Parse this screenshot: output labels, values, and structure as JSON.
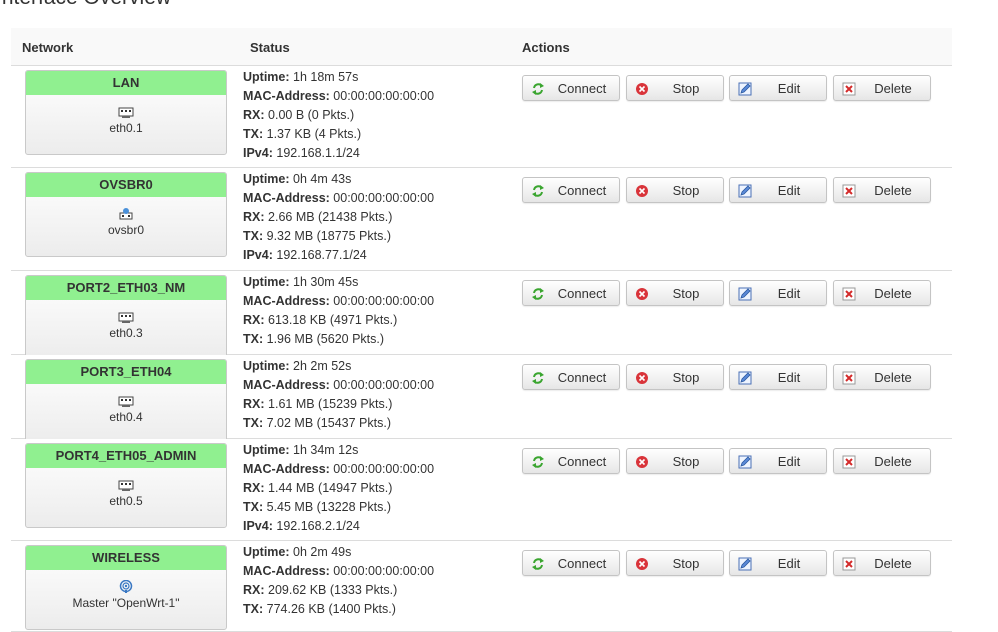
{
  "page": {
    "title": "Interface Overview"
  },
  "table": {
    "headers": {
      "network": "Network",
      "status": "Status",
      "actions": "Actions"
    }
  },
  "buttons": {
    "connect": "Connect",
    "stop": "Stop",
    "edit": "Edit",
    "delete": "Delete"
  },
  "labels": {
    "uptime": "Uptime:",
    "mac": "MAC-Address:",
    "rx": "RX:",
    "tx": "TX:",
    "ipv4": "IPv4:"
  },
  "interfaces": [
    {
      "name": "LAN",
      "device": "eth0.1",
      "icon": "ethernet-port-icon",
      "uptime": "1h 18m 57s",
      "mac": "00:00:00:00:00:00",
      "rx": "0.00 B (0 Pkts.)",
      "tx": "1.37 KB (4 Pkts.)",
      "ipv4": "192.168.1.1/24"
    },
    {
      "name": "OVSBR0",
      "device": "ovsbr0",
      "icon": "bridge-icon",
      "uptime": "0h 4m 43s",
      "mac": "00:00:00:00:00:00",
      "rx": "2.66 MB (21438 Pkts.)",
      "tx": "9.32 MB (18775 Pkts.)",
      "ipv4": "192.168.77.1/24"
    },
    {
      "name": "PORT2_ETH03_NM",
      "device": "eth0.3",
      "icon": "ethernet-port-icon",
      "uptime": "1h 30m 45s",
      "mac": "00:00:00:00:00:00",
      "rx": "613.18 KB (4971 Pkts.)",
      "tx": "1.96 MB (5620 Pkts.)"
    },
    {
      "name": "PORT3_ETH04",
      "device": "eth0.4",
      "icon": "ethernet-port-icon",
      "uptime": "2h 2m 52s",
      "mac": "00:00:00:00:00:00",
      "rx": "1.61 MB (15239 Pkts.)",
      "tx": "7.02 MB (15437 Pkts.)"
    },
    {
      "name": "PORT4_ETH05_ADMIN",
      "device": "eth0.5",
      "icon": "ethernet-port-icon",
      "uptime": "1h 34m 12s",
      "mac": "00:00:00:00:00:00",
      "rx": "1.44 MB (14947 Pkts.)",
      "tx": "5.45 MB (13228 Pkts.)",
      "ipv4": "192.168.2.1/24"
    },
    {
      "name": "WIRELESS",
      "device": "Master \"OpenWrt-1\"",
      "icon": "wifi-icon",
      "uptime": "0h 2m 49s",
      "mac": "00:00:00:00:00:00",
      "rx": "209.62 KB (1333 Pkts.)",
      "tx": "774.26 KB (1400 Pkts.)"
    }
  ],
  "colors": {
    "interface_header": "#90f090",
    "row_border": "#dcdcdc",
    "button_border": "#c4c4c4"
  }
}
